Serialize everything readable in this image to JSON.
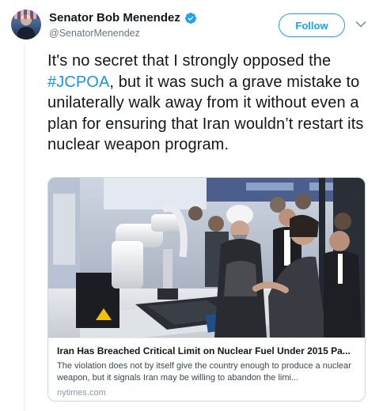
{
  "tweet": {
    "author_name": "Senator Bob Menendez",
    "handle": "@SenatorMenendez",
    "follow_label": "Follow",
    "text_before": "It's no secret that I strongly opposed the ",
    "hashtag": "#JCPOA",
    "text_after": ", but it was such a grave mistake to unilaterally walk away from it without even a plan for ensuring that Iran wouldn’t restart its nuclear weapon program.",
    "icons": {
      "verified": "verified-badge-icon",
      "more": "chevron-down-icon"
    }
  },
  "card": {
    "title": "Iran Has Breached Critical Limit on Nuclear Fuel Under 2015 Pa...",
    "description": "The violation does not by itself give the country enough to produce a nuclear weapon, but it signals Iran may be willing to abandon the limi...",
    "domain": "nytimes.com"
  },
  "colors": {
    "accent": "#1da1f2",
    "hashtag": "#1b95e0",
    "text": "#14171a",
    "secondary": "#657786"
  }
}
